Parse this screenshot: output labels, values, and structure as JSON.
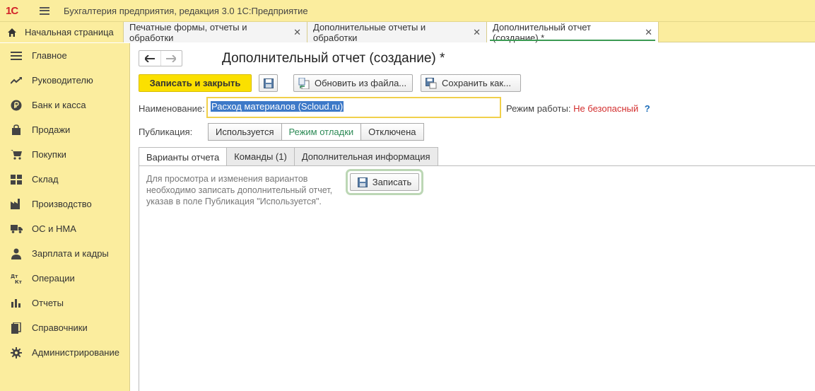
{
  "window": {
    "logo_text": "1С",
    "title": "Бухгалтерия предприятия, редакция 3.0 1С:Предприятие"
  },
  "tabs": [
    {
      "label": "Начальная страница",
      "closable": false,
      "active": false
    },
    {
      "label": "Печатные формы, отчеты и обработки",
      "closable": true,
      "active": false
    },
    {
      "label": "Дополнительные отчеты и обработки",
      "closable": true,
      "active": false
    },
    {
      "label": "Дополнительный отчет (создание) *",
      "closable": true,
      "active": true
    }
  ],
  "tab_close_glyph": "✕",
  "sidebar": {
    "items": [
      {
        "label": "Главное",
        "icon": "list-icon"
      },
      {
        "label": "Руководителю",
        "icon": "trend-icon"
      },
      {
        "label": "Банк и касса",
        "icon": "ruble-icon"
      },
      {
        "label": "Продажи",
        "icon": "bag-icon"
      },
      {
        "label": "Покупки",
        "icon": "cart-icon"
      },
      {
        "label": "Склад",
        "icon": "grid-icon"
      },
      {
        "label": "Производство",
        "icon": "factory-icon"
      },
      {
        "label": "ОС и НМА",
        "icon": "truck-icon"
      },
      {
        "label": "Зарплата и кадры",
        "icon": "person-icon"
      },
      {
        "label": "Операции",
        "icon": "dt-kt-icon"
      },
      {
        "label": "Отчеты",
        "icon": "bar-chart-icon"
      },
      {
        "label": "Справочники",
        "icon": "books-icon"
      },
      {
        "label": "Администрирование",
        "icon": "gear-icon"
      }
    ]
  },
  "form": {
    "title": "Дополнительный отчет (создание) *",
    "toolbar": {
      "save_close": "Записать и закрыть",
      "update_from_file": "Обновить из файла...",
      "save_as": "Сохранить как..."
    },
    "name_label": "Наименование:",
    "name_value": "Расход материалов (Scloud.ru)",
    "mode_label": "Режим работы:",
    "mode_value": "Не безопасный",
    "mode_help": "?",
    "publication_label": "Публикация:",
    "publication_options": [
      "Используется",
      "Режим отладки",
      "Отключена"
    ],
    "publication_selected": "Режим отладки",
    "form_tabs": [
      "Варианты отчета",
      "Команды (1)",
      "Дополнительная информация"
    ],
    "hint_text": "Для просмотра и изменения вариантов необходимо записать дополнительный отчет, указав в поле Публикация \"Используется\".",
    "write_button": "Записать"
  },
  "colors": {
    "sidebar_bg": "#fbed9e",
    "primary_button": "#fbe000",
    "mode_unsafe": "#d32f2f",
    "active_segment": "#2e8b57",
    "selection": "#3d79c8"
  }
}
